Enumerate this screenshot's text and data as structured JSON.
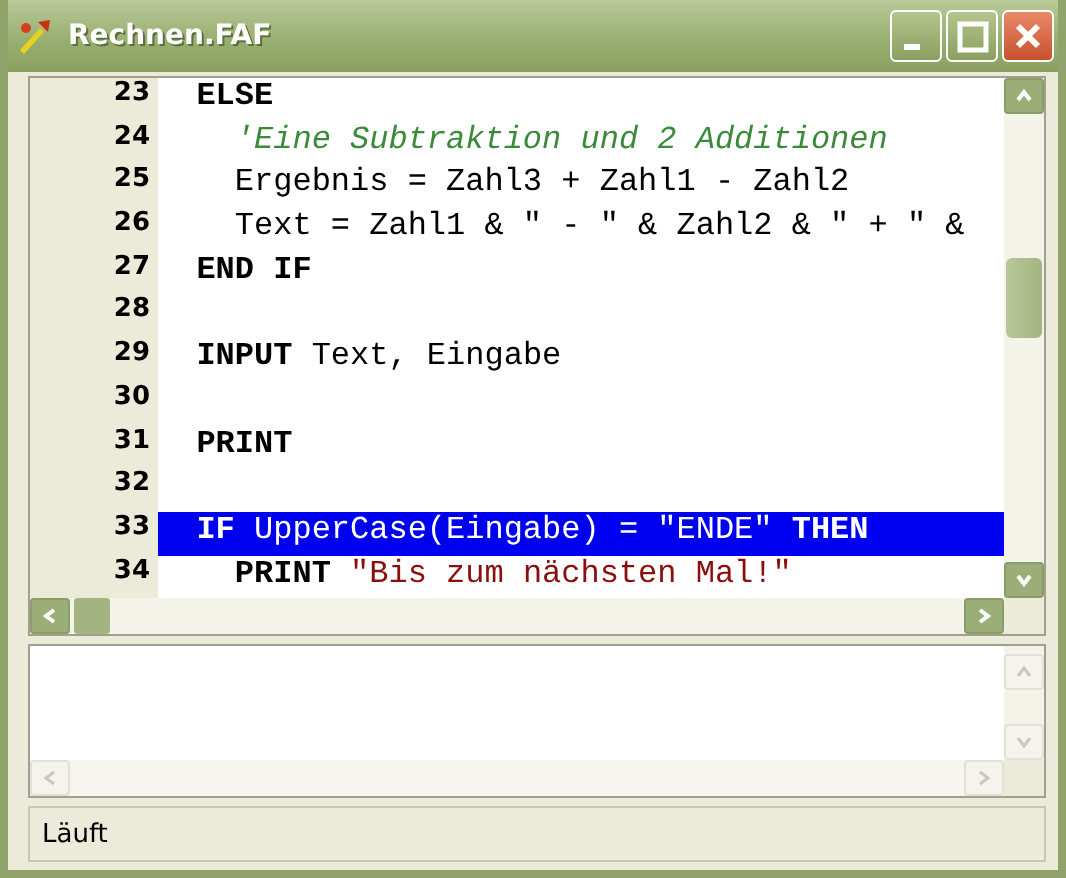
{
  "window": {
    "title": "Rechnen.FAF"
  },
  "editor": {
    "lines": [
      {
        "number": "23",
        "selected": false,
        "tokens": [
          {
            "kind": "keyword",
            "text": "  ELSE"
          }
        ]
      },
      {
        "number": "24",
        "selected": false,
        "tokens": [
          {
            "kind": "comment",
            "text": "    'Eine Subtraktion und 2 Additionen"
          }
        ]
      },
      {
        "number": "25",
        "selected": false,
        "tokens": [
          {
            "kind": "plain",
            "text": "    Ergebnis = Zahl3 + Zahl1 - Zahl2"
          }
        ]
      },
      {
        "number": "26",
        "selected": false,
        "tokens": [
          {
            "kind": "plain",
            "text": "    Text = Zahl1 & \" - \" & Zahl2 & \" + \" &"
          }
        ]
      },
      {
        "number": "27",
        "selected": false,
        "tokens": [
          {
            "kind": "keyword",
            "text": "  END IF"
          }
        ]
      },
      {
        "number": "28",
        "selected": false
      },
      {
        "number": "29",
        "selected": false,
        "tokens": [
          {
            "kind": "keyword",
            "text": "  INPUT"
          },
          {
            "kind": "plain",
            "text": " Text, Eingabe"
          }
        ]
      },
      {
        "number": "30",
        "selected": false
      },
      {
        "number": "31",
        "selected": false,
        "tokens": [
          {
            "kind": "keyword",
            "text": "  PRINT"
          }
        ]
      },
      {
        "number": "32",
        "selected": false
      },
      {
        "number": "33",
        "selected": true,
        "tokens": [
          {
            "kind": "keyword",
            "text": "  IF"
          },
          {
            "kind": "plain",
            "text": " UpperCase(Eingabe) = "
          },
          {
            "kind": "string",
            "text": "\"ENDE\""
          },
          {
            "kind": "keyword",
            "text": " THEN"
          }
        ]
      },
      {
        "number": "34",
        "selected": false,
        "tokens": [
          {
            "kind": "keyword",
            "text": "    PRINT"
          },
          {
            "kind": "string",
            "text": " \"Bis zum nächsten Mal!\""
          }
        ]
      }
    ]
  },
  "status_bar": {
    "text": "Läuft"
  }
}
